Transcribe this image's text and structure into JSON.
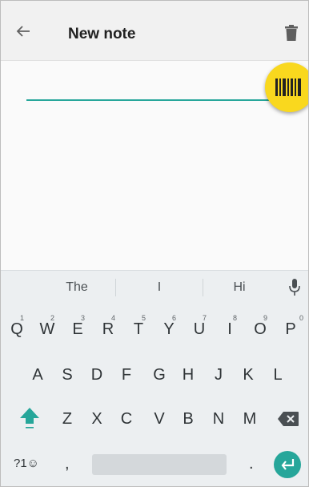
{
  "app": {
    "title": "New note"
  },
  "note": {
    "value": "",
    "placeholder": ""
  },
  "keyboard": {
    "suggestions": [
      "The",
      "I",
      "Hi"
    ],
    "row1": [
      {
        "key": "Q",
        "hint": "1"
      },
      {
        "key": "W",
        "hint": "2"
      },
      {
        "key": "E",
        "hint": "3"
      },
      {
        "key": "R",
        "hint": "4"
      },
      {
        "key": "T",
        "hint": "5"
      },
      {
        "key": "Y",
        "hint": "6"
      },
      {
        "key": "U",
        "hint": "7"
      },
      {
        "key": "I",
        "hint": "8"
      },
      {
        "key": "O",
        "hint": "9"
      },
      {
        "key": "P",
        "hint": "0"
      }
    ],
    "row2": [
      "A",
      "S",
      "D",
      "F",
      "G",
      "H",
      "J",
      "K",
      "L"
    ],
    "row3": [
      "Z",
      "X",
      "C",
      "V",
      "B",
      "N",
      "M"
    ],
    "symbols_label": "?1☺",
    "comma": ",",
    "period": "."
  },
  "colors": {
    "accent": "#26a69a",
    "fab": "#f9d81e",
    "appbar": "#f1f1f1",
    "keyboard": "#eceff1"
  },
  "icons": {
    "back": "arrow-left-icon",
    "delete": "trash-icon",
    "barcode": "barcode-icon",
    "mic": "mic-icon",
    "shift": "shift-icon",
    "backspace": "backspace-icon",
    "enter": "enter-icon"
  }
}
